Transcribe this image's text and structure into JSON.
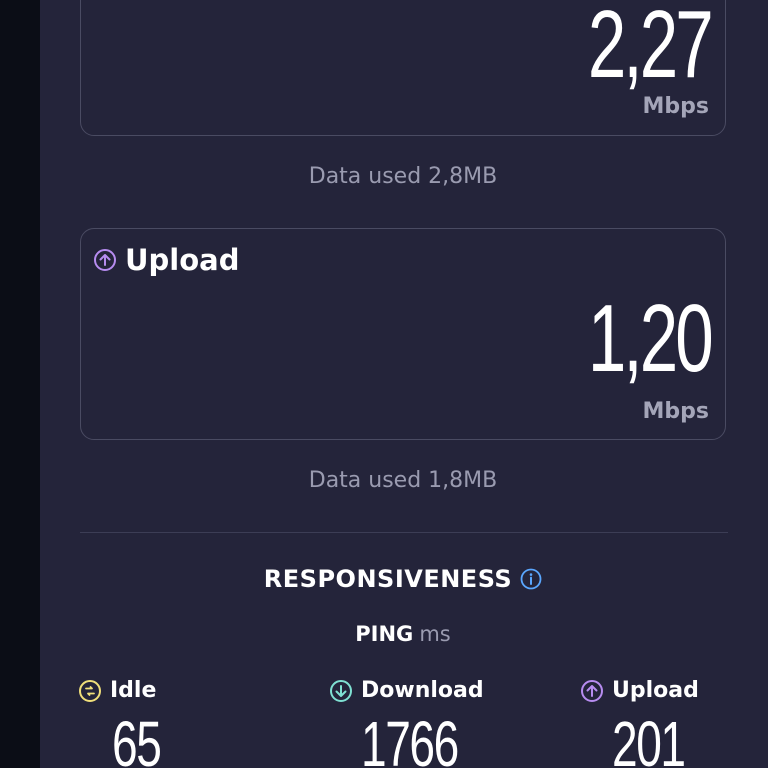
{
  "download": {
    "value": "2,27",
    "unit": "Mbps",
    "data_used": "Data used 2,8MB"
  },
  "upload": {
    "label": "Upload",
    "value": "1,20",
    "unit": "Mbps",
    "data_used": "Data used 1,8MB"
  },
  "responsiveness": {
    "title": "RESPONSIVENESS",
    "ping_label": "PING",
    "ping_unit": "ms",
    "metrics": [
      {
        "label": "Idle",
        "value": "65",
        "icon": "idle-icon",
        "color": "#f0df7a"
      },
      {
        "label": "Download",
        "value": "1766",
        "icon": "arrow-down-circle-icon",
        "color": "#7fe0d2"
      },
      {
        "label": "Upload",
        "value": "201",
        "icon": "arrow-up-circle-icon",
        "color": "#b78cf0"
      }
    ]
  },
  "colors": {
    "background": "#24243a",
    "upload_accent": "#b78cf0",
    "info_accent": "#5aa7ff"
  }
}
